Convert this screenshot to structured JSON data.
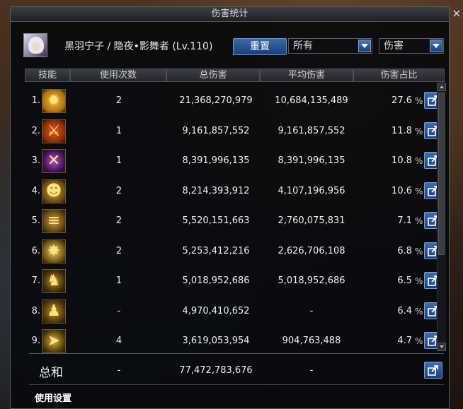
{
  "window": {
    "title": "伤害统计"
  },
  "character": {
    "name": "黑羽宁子 / 隐夜•影舞者 (Lv.110)"
  },
  "controls": {
    "reset_label": "重置",
    "filter_value": "所有",
    "sort_value": "伤害"
  },
  "table": {
    "headers": [
      "技能",
      "使用次数",
      "总伤害",
      "平均伤害",
      "伤害占比"
    ],
    "rows": [
      {
        "index": "1.",
        "icon": "golden-burst-skill-icon",
        "count": "2",
        "total": "21,368,270,979",
        "avg": "10,684,135,489",
        "pct": "27.6"
      },
      {
        "index": "2.",
        "icon": "fire-slash-skill-icon",
        "count": "1",
        "total": "9,161,857,552",
        "avg": "9,161,857,552",
        "pct": "11.8"
      },
      {
        "index": "3.",
        "icon": "purple-cross-skill-icon",
        "count": "1",
        "total": "8,391,996,135",
        "avg": "8,391,996,135",
        "pct": "10.8"
      },
      {
        "index": "4.",
        "icon": "golden-mask-skill-icon",
        "count": "2",
        "total": "8,214,393,912",
        "avg": "4,107,196,956",
        "pct": "10.6"
      },
      {
        "index": "5.",
        "icon": "blade-dash-skill-icon",
        "count": "2",
        "total": "5,520,151,663",
        "avg": "2,760,075,831",
        "pct": "7.1"
      },
      {
        "index": "6.",
        "icon": "star-explosion-skill-icon",
        "count": "2",
        "total": "5,253,412,216",
        "avg": "2,626,706,108",
        "pct": "6.8"
      },
      {
        "index": "7.",
        "icon": "shadow-figure-skill-icon",
        "count": "1",
        "total": "5,018,952,686",
        "avg": "5,018,952,686",
        "pct": "6.5"
      },
      {
        "index": "8.",
        "icon": "rising-figure-skill-icon",
        "count": "-",
        "total": "4,970,410,652",
        "avg": "-",
        "pct": "6.4"
      },
      {
        "index": "9.",
        "icon": "arrow-strike-skill-icon",
        "count": "4",
        "total": "3,619,053,954",
        "avg": "904,763,488",
        "pct": "4.7"
      }
    ],
    "pct_sign": "%"
  },
  "summary": {
    "label": "总和",
    "count": "-",
    "total": "77,472,783,676",
    "avg": "-"
  },
  "footer": {
    "settings_label": "使用设置"
  },
  "colors": {
    "accent_blue": "#2a5596",
    "panel_bg": "#080a0e",
    "icon_gold": "#e8b030"
  }
}
